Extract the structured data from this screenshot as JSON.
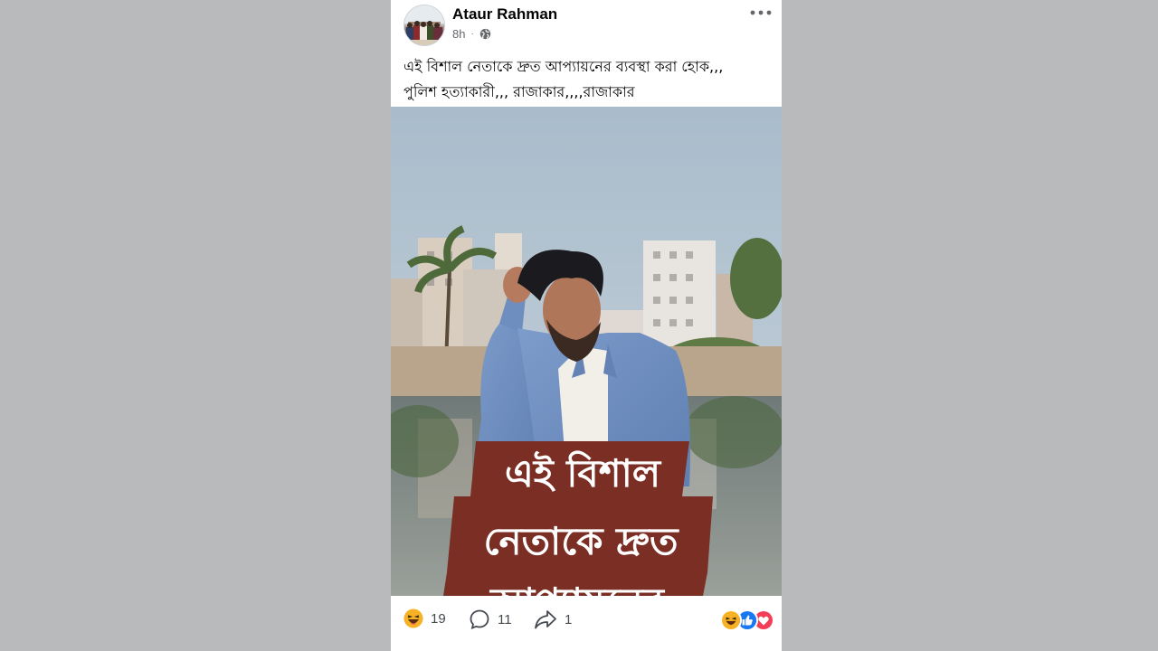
{
  "post": {
    "author": "Ataur Rahman",
    "timestamp": "8h",
    "visibility_icon": "globe-icon",
    "caption_lines": [
      "এই বিশাল নেতাকে দ্রুত আপ্যায়নের ব্যবস্থা করা হোক,,,",
      "পুলিশ হত্যাকারী,,, রাজাকার,,,,রাজাকার"
    ],
    "overlay_lines": [
      "এই বিশাল",
      "নেতাকে দ্রুত",
      "আপ্যায়নের"
    ]
  },
  "footer": {
    "reactions_count": "19",
    "comments_count": "11",
    "shares_count": "1",
    "reaction_types": [
      "haha-icon",
      "like-icon",
      "love-icon"
    ]
  },
  "colors": {
    "overlay_banner": "#7a2e24",
    "like_blue": "#1877f2",
    "love_red": "#f33e58",
    "haha_yellow": "#f7b125"
  }
}
